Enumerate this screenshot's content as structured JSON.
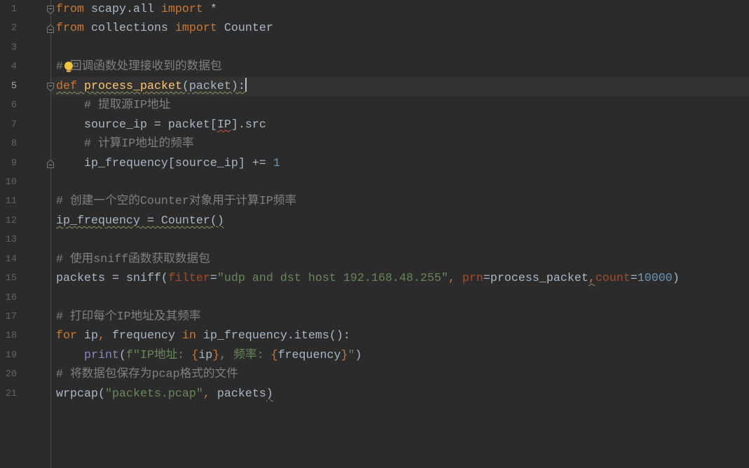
{
  "colors": {
    "background": "#2b2b2b",
    "current_line": "#323232",
    "line_number": "#606366",
    "line_number_current": "#a4a3a3",
    "plain": "#a9b7c6",
    "keyword": "#cc7832",
    "punct": "#cc7832",
    "comment": "#808080",
    "function": "#ffc66d",
    "number": "#6897bb",
    "string": "#6a8759",
    "param": "#aa4926",
    "builtin": "#8888c6",
    "weak_warning": "#8f9160",
    "typo": "#c0564a",
    "lightbulb": "#f0c33c"
  },
  "icons": {
    "fold_start": "fold-start-icon",
    "fold_end": "fold-end-icon",
    "intention": "lightbulb-icon"
  },
  "lines": [
    {
      "number": "1",
      "fold": "start",
      "tokens": [
        {
          "text": "from",
          "type": "keyword"
        },
        {
          "text": " scapy.all ",
          "type": "plain"
        },
        {
          "text": "import",
          "type": "keyword"
        },
        {
          "text": " *",
          "type": "plain"
        }
      ]
    },
    {
      "number": "2",
      "fold": "end",
      "tokens": [
        {
          "text": "from",
          "type": "keyword"
        },
        {
          "text": " collections ",
          "type": "plain"
        },
        {
          "text": "import",
          "type": "keyword"
        },
        {
          "text": " Counter",
          "type": "plain"
        }
      ]
    },
    {
      "number": "3",
      "tokens": []
    },
    {
      "number": "4",
      "bulb": true,
      "tokens": [
        {
          "text": "# 回调函数处理接收到的数据包",
          "type": "comment"
        }
      ]
    },
    {
      "number": "5",
      "fold": "start",
      "current": true,
      "caret": true,
      "tokens": [
        {
          "text": "def",
          "type": "keyword",
          "mark": "weak"
        },
        {
          "text": " ",
          "type": "plain",
          "mark": "weak"
        },
        {
          "text": "process_packet",
          "type": "function",
          "mark": "weak"
        },
        {
          "text": "(packet):",
          "type": "plain",
          "mark": "weak"
        }
      ]
    },
    {
      "number": "6",
      "tokens": [
        {
          "text": "    ",
          "type": "plain"
        },
        {
          "text": "# 提取源IP地址",
          "type": "comment"
        }
      ]
    },
    {
      "number": "7",
      "tokens": [
        {
          "text": "    source_ip = packet[",
          "type": "plain"
        },
        {
          "text": "IP",
          "type": "plain",
          "mark": "typo"
        },
        {
          "text": "].src",
          "type": "plain"
        }
      ]
    },
    {
      "number": "8",
      "tokens": [
        {
          "text": "    ",
          "type": "plain"
        },
        {
          "text": "# 计算IP地址的频率",
          "type": "comment"
        }
      ]
    },
    {
      "number": "9",
      "fold": "end",
      "tokens": [
        {
          "text": "    ip_frequency[source_ip] += ",
          "type": "plain"
        },
        {
          "text": "1",
          "type": "number"
        }
      ]
    },
    {
      "number": "10",
      "tokens": []
    },
    {
      "number": "11",
      "tokens": [
        {
          "text": "# 创建一个空的Counter对象用于计算IP频率",
          "type": "comment"
        }
      ]
    },
    {
      "number": "12",
      "tokens": [
        {
          "text": "ip_frequency = Counter()",
          "type": "plain",
          "mark": "weak"
        }
      ]
    },
    {
      "number": "13",
      "tokens": []
    },
    {
      "number": "14",
      "tokens": [
        {
          "text": "# 使用sniff函数获取数据包",
          "type": "comment"
        }
      ]
    },
    {
      "number": "15",
      "tokens": [
        {
          "text": "packets = sniff(",
          "type": "plain"
        },
        {
          "text": "filter",
          "type": "param"
        },
        {
          "text": "=",
          "type": "plain"
        },
        {
          "text": "\"udp and dst host 192.168.48.255\"",
          "type": "string"
        },
        {
          "text": ", ",
          "type": "punct"
        },
        {
          "text": "prn",
          "type": "param"
        },
        {
          "text": "=process_packet",
          "type": "plain"
        },
        {
          "text": ",",
          "type": "punct",
          "mark": "weak"
        },
        {
          "text": "count",
          "type": "param"
        },
        {
          "text": "=",
          "type": "plain"
        },
        {
          "text": "10000",
          "type": "number"
        },
        {
          "text": ")",
          "type": "plain"
        }
      ]
    },
    {
      "number": "16",
      "tokens": []
    },
    {
      "number": "17",
      "tokens": [
        {
          "text": "# 打印每个IP地址及其频率",
          "type": "comment"
        }
      ]
    },
    {
      "number": "18",
      "tokens": [
        {
          "text": "for",
          "type": "keyword"
        },
        {
          "text": " ip",
          "type": "plain"
        },
        {
          "text": ",",
          "type": "punct"
        },
        {
          "text": " frequency ",
          "type": "plain"
        },
        {
          "text": "in",
          "type": "keyword"
        },
        {
          "text": " ip_frequency.items():",
          "type": "plain"
        }
      ]
    },
    {
      "number": "19",
      "tokens": [
        {
          "text": "    ",
          "type": "plain"
        },
        {
          "text": "print",
          "type": "builtin"
        },
        {
          "text": "(",
          "type": "plain"
        },
        {
          "text": "f\"IP地址: ",
          "type": "string"
        },
        {
          "text": "{",
          "type": "keyword"
        },
        {
          "text": "ip",
          "type": "plain"
        },
        {
          "text": "}",
          "type": "keyword"
        },
        {
          "text": ", 频率: ",
          "type": "string"
        },
        {
          "text": "{",
          "type": "keyword"
        },
        {
          "text": "frequency",
          "type": "plain"
        },
        {
          "text": "}",
          "type": "keyword"
        },
        {
          "text": "\"",
          "type": "string"
        },
        {
          "text": ")",
          "type": "plain"
        }
      ]
    },
    {
      "number": "20",
      "tokens": [
        {
          "text": "# 将数据包保存为pcap格式的文件",
          "type": "comment"
        }
      ]
    },
    {
      "number": "21",
      "tokens": [
        {
          "text": "wrpcap(",
          "type": "plain"
        },
        {
          "text": "\"packets.pcap\"",
          "type": "string"
        },
        {
          "text": ", ",
          "type": "punct"
        },
        {
          "text": "packets",
          "type": "plain"
        },
        {
          "text": ")",
          "type": "plain",
          "mark": "weak"
        }
      ]
    }
  ]
}
